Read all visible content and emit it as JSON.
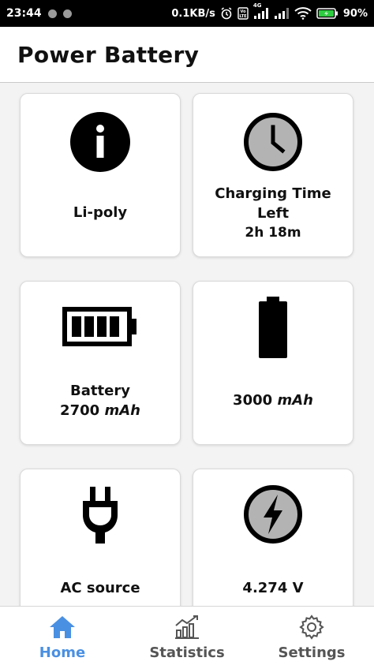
{
  "status_bar": {
    "time": "23:44",
    "speed": "0.1KB/s",
    "network": "4G",
    "battery_percent": "90%"
  },
  "app_bar": {
    "title": "Power Battery"
  },
  "cards": [
    {
      "icon": "info-icon",
      "line1": "Li-poly"
    },
    {
      "icon": "clock-icon",
      "line1": "Charging Time",
      "line2": "Left",
      "line3": "2h 18m"
    },
    {
      "icon": "battery-horizontal-icon",
      "line1": "Battery",
      "value": "2700",
      "unit": "mAh"
    },
    {
      "icon": "battery-vertical-icon",
      "value": "3000",
      "unit": "mAh"
    },
    {
      "icon": "plug-icon",
      "line1": "AC source"
    },
    {
      "icon": "bolt-icon",
      "line1": "4.274 V"
    }
  ],
  "bottom_nav": [
    {
      "label": "Home",
      "icon": "home-icon",
      "active": true
    },
    {
      "label": "Statistics",
      "icon": "chart-icon",
      "active": false
    },
    {
      "label": "Settings",
      "icon": "gear-icon",
      "active": false
    }
  ],
  "colors": {
    "accent": "#4a90e2",
    "status_bar": "#000000",
    "battery_bolt": "#2ecc40"
  }
}
